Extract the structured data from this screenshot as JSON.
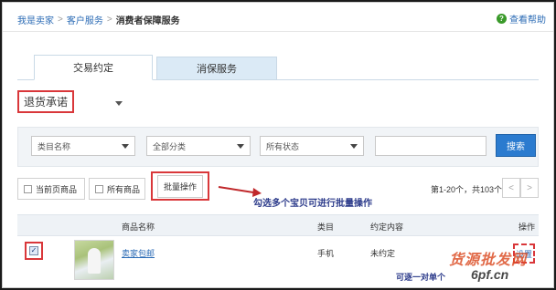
{
  "breadcrumb": {
    "items": [
      "我是卖家",
      "客户服务"
    ],
    "separator": ">",
    "current": "消费者保障服务"
  },
  "help": {
    "label": "查看帮助",
    "icon": "question-icon"
  },
  "tabs": [
    {
      "label": "交易约定",
      "active": true
    },
    {
      "label": "消保服务",
      "active": false
    }
  ],
  "returns_select": {
    "value": "退货承诺"
  },
  "filters": {
    "category": "类目名称",
    "classification": "全部分类",
    "status": "所有状态",
    "search_value": "",
    "search_button": "搜索"
  },
  "toolbar": {
    "current_page_label": "当前页商品",
    "all_items_label": "所有商品",
    "batch_label": "批量操作",
    "pagination": "第1-20个，共103个",
    "prev_icon": "chevron-left-icon",
    "next_icon": "chevron-right-icon"
  },
  "annotations": {
    "batch_hint": "勾选多个宝贝可进行批量操作",
    "single_hint": "可逐一对单个",
    "watermark_top": "货源批发网",
    "watermark_bottom": "6pf.cn"
  },
  "table": {
    "columns": [
      "商品名称",
      "类目",
      "约定内容",
      "操作"
    ],
    "rows": [
      {
        "checked": true,
        "name": "卖家包邮",
        "category": "手机",
        "status": "未约定",
        "op": "设置"
      }
    ]
  },
  "colors": {
    "link": "#2b6bb5",
    "accent_red": "#d9373a",
    "search_btn": "#2b7bcf",
    "annotation": "#2b3a8a"
  }
}
